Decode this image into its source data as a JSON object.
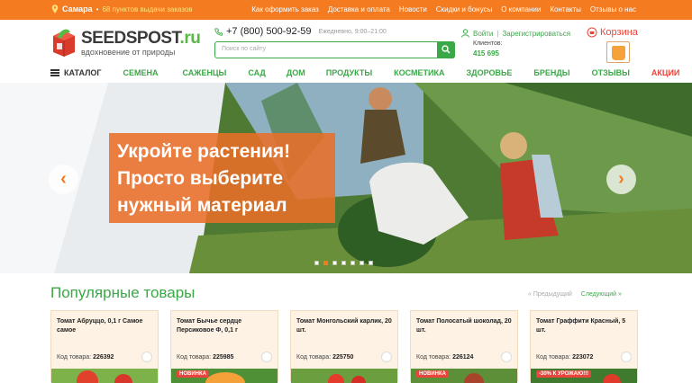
{
  "topbar": {
    "city": "Самара",
    "pickup": "68 пунктов выдачи заказов",
    "nav": [
      "Как оформить заказ",
      "Доставка и оплата",
      "Новости",
      "Скидки и бонусы",
      "О компании",
      "Контакты",
      "Отзывы о нас"
    ]
  },
  "header": {
    "logo_main": "SEEDSPOST",
    "logo_suffix": ".ru",
    "tagline": "вдохновение от природы",
    "phone": "+7 (800) 500-92-59",
    "hours": "Ежедневно, 9:00–21:00",
    "search_placeholder": "Поиск по сайту",
    "login": "Войти",
    "register": "Зарегистрироваться",
    "clients_label": "Клиентов:",
    "clients_count": "415 695",
    "cart": "Корзина"
  },
  "menu": {
    "catalog": "КАТАЛОГ",
    "items": [
      "СЕМЕНА",
      "САЖЕНЦЫ",
      "САД",
      "ДОМ",
      "ПРОДУКТЫ",
      "КОСМЕТИКА",
      "ЗДОРОВЬЕ",
      "БРЕНДЫ",
      "ОТЗЫВЫ",
      "АКЦИИ"
    ]
  },
  "hero": {
    "line1": "Укройте растения!",
    "line2": "Просто выберите",
    "line3": "нужный материал"
  },
  "popular": {
    "title": "Популярные товары",
    "prev": "Предыдущий",
    "next": "Следующий",
    "code_label": "Код товара:",
    "products": [
      {
        "title": "Томат Абруццо, 0,1 г Самое самое",
        "code": "226392"
      },
      {
        "title": "Томат Бычье сердце Персиковое Ф, 0,1 г",
        "code": "225985"
      },
      {
        "title": "Томат Монгольский карлик, 20 шт.",
        "code": "225750"
      },
      {
        "title": "Томат Полосатый шоколад, 20 шт.",
        "code": "226124"
      },
      {
        "title": "Томат Граффити Красный, 5 шт.",
        "code": "223072"
      }
    ],
    "badges": [
      "НОВИНКА",
      "НОВИНКА",
      "-30% К УРОЖАЮ!!!"
    ]
  },
  "colors": {
    "accent_orange": "#f47b20",
    "brand_green": "#3aa847",
    "sale_red": "#e8453c"
  }
}
